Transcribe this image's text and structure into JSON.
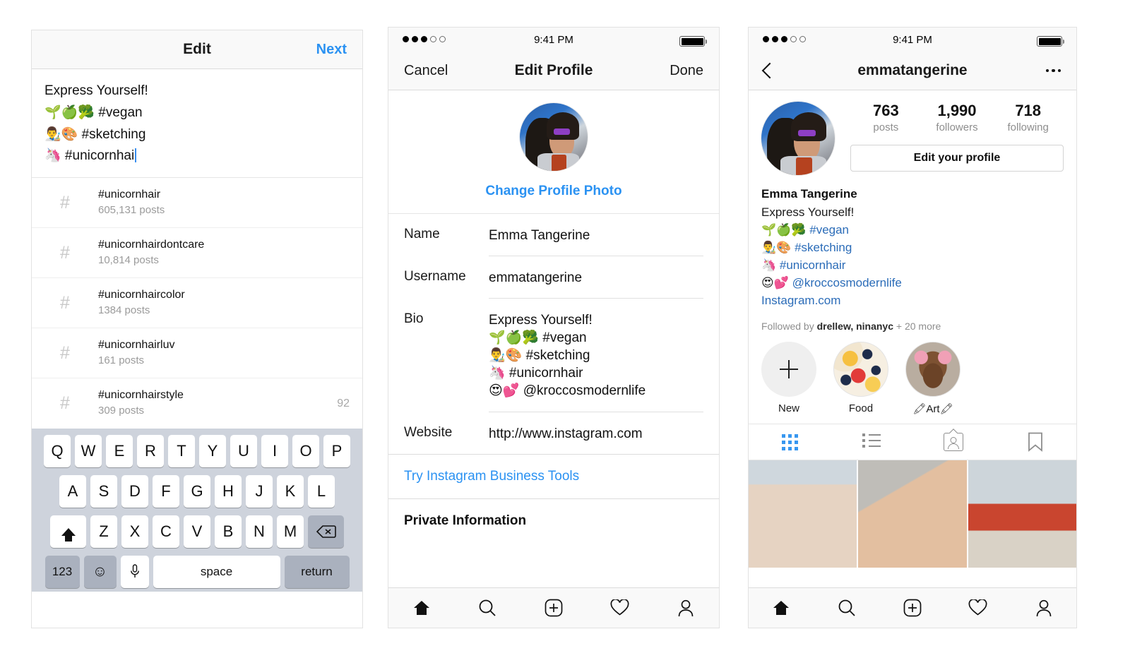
{
  "status_bar": {
    "time": "9:41 PM",
    "signal_filled": 3,
    "signal_total": 5,
    "battery": "full"
  },
  "left_panel": {
    "nav": {
      "title": "Edit",
      "action_label": "Next"
    },
    "caption": {
      "lines": [
        "Express Yourself!",
        "🌱🍏🥦 #vegan",
        "👨‍🎨🎨 #sketching",
        "🦄 #unicornhai"
      ],
      "has_caret": true
    },
    "suggestions": [
      {
        "icon": "#",
        "tag": "#unicornhair",
        "count": "605,131 posts",
        "badge": ""
      },
      {
        "icon": "#",
        "tag": "#unicornhairdontcare",
        "count": "10,814 posts",
        "badge": ""
      },
      {
        "icon": "#",
        "tag": "#unicornhaircolor",
        "count": "1384 posts",
        "badge": ""
      },
      {
        "icon": "#",
        "tag": "#unicornhairluv",
        "count": "161 posts",
        "badge": ""
      },
      {
        "icon": "#",
        "tag": "#unicornhairstyle",
        "count": "309 posts",
        "badge": "92"
      }
    ],
    "keyboard": {
      "row1": [
        "Q",
        "W",
        "E",
        "R",
        "T",
        "Y",
        "U",
        "I",
        "O",
        "P"
      ],
      "row2": [
        "A",
        "S",
        "D",
        "F",
        "G",
        "H",
        "J",
        "K",
        "L"
      ],
      "row3": [
        "Z",
        "X",
        "C",
        "V",
        "B",
        "N",
        "M"
      ],
      "shift_label": "shift-icon",
      "backspace_label": "backspace-icon",
      "numbers_label": "123",
      "emoji_label": "☺",
      "mic_label": "mic-icon",
      "space_label": "space",
      "return_label": "return"
    }
  },
  "middle_panel": {
    "nav": {
      "cancel": "Cancel",
      "title": "Edit Profile",
      "done": "Done"
    },
    "change_photo": "Change Profile Photo",
    "fields": [
      {
        "label": "Name",
        "value": "Emma Tangerine"
      },
      {
        "label": "Username",
        "value": "emmatangerine"
      },
      {
        "label": "Bio",
        "value": "Express Yourself!\n🌱🍏🥦 #vegan\n👨‍🎨🎨 #sketching\n🦄 #unicornhair\n😍💕 @kroccosmodernlife"
      },
      {
        "label": "Website",
        "value": "http://www.instagram.com"
      }
    ],
    "business_tools": "Try Instagram Business Tools",
    "private_information": "Private Information",
    "tabbar": [
      "home-icon",
      "search-icon",
      "add-post-icon",
      "activity-icon",
      "profile-icon"
    ]
  },
  "right_panel": {
    "nav": {
      "back": "back-icon",
      "title": "emmatangerine",
      "more": "more-options-icon"
    },
    "stats": [
      {
        "number": "763",
        "label": "posts"
      },
      {
        "number": "1,990",
        "label": "followers"
      },
      {
        "number": "718",
        "label": "following"
      }
    ],
    "edit_profile_button": "Edit your profile",
    "display_name": "Emma Tangerine",
    "bio_lines": [
      {
        "text": "Express Yourself!",
        "tag": ""
      },
      {
        "emoji": "🌱🍏🥦 ",
        "tag": "#vegan"
      },
      {
        "emoji": "👨‍🎨🎨 ",
        "tag": "#sketching"
      },
      {
        "emoji": "🦄 ",
        "tag": "#unicornhair"
      },
      {
        "emoji": "😍💕 ",
        "tag": "@kroccosmodernlife"
      }
    ],
    "website": "Instagram.com",
    "followed_by_prefix": "Followed by ",
    "followed_by_names": "drellew, ninanyc",
    "followed_by_suffix": " + 20 more",
    "highlights": [
      {
        "label": "New",
        "kind": "new"
      },
      {
        "label": "Food",
        "kind": "food"
      },
      {
        "label": "🖍Art🖍",
        "kind": "dog"
      }
    ],
    "segments": [
      "grid-icon",
      "list-icon",
      "tagged-icon",
      "saved-icon"
    ],
    "active_segment": 0,
    "tabbar": [
      "home-icon",
      "search-icon",
      "add-post-icon",
      "activity-icon",
      "profile-icon"
    ]
  },
  "colors": {
    "accent_blue": "#2b92f2",
    "link_blue": "#2b6cb8",
    "active_tab": "#3897f0",
    "muted": "#8e8e8e"
  }
}
